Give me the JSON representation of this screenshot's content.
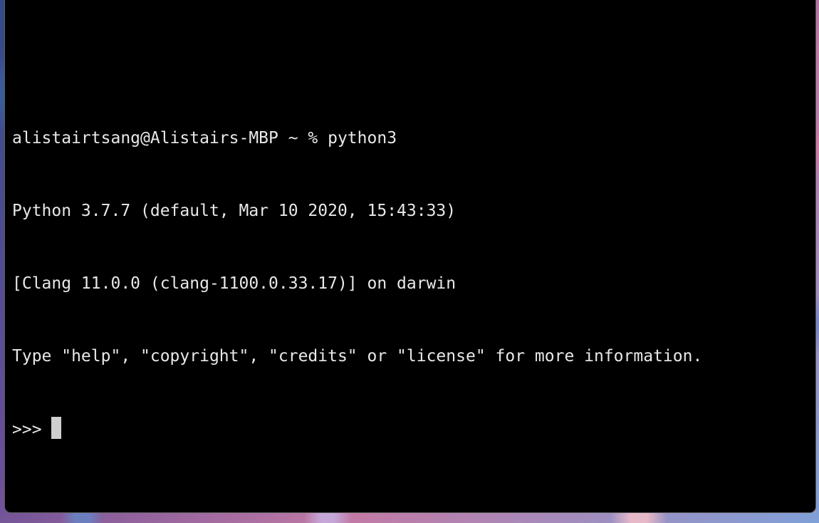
{
  "terminal": {
    "lines": [
      "",
      "alistairtsang@Alistairs-MBP ~ % python3",
      "Python 3.7.7 (default, Mar 10 2020, 15:43:33)",
      "[Clang 11.0.0 (clang-1100.0.33.17)] on darwin",
      "Type \"help\", \"copyright\", \"credits\" or \"license\" for more information."
    ],
    "prompt": ">>> "
  },
  "colors": {
    "background": "#000000",
    "text": "#e8e8e8",
    "cursor": "#cfcfcf"
  }
}
